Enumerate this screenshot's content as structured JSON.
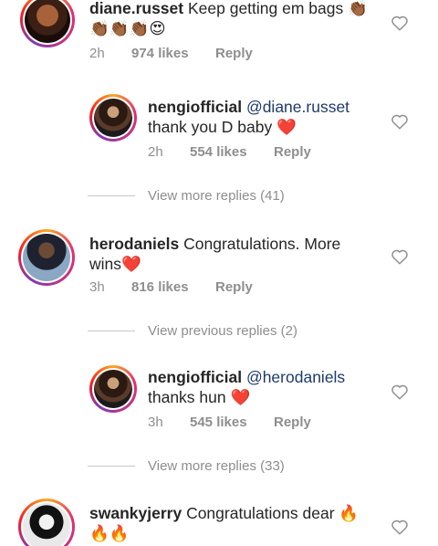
{
  "comments": [
    {
      "username": "diane.russet",
      "text": "Keep getting em bags 👏🏾",
      "text2": "👏🏾👏🏾👏🏾😍",
      "time": "2h",
      "likes": "974 likes",
      "reply": "Reply"
    },
    {
      "username": "nengiofficial",
      "mention": "@diane.russet",
      "text": "thank you D baby",
      "time": "2h",
      "likes": "554 likes",
      "reply": "Reply"
    },
    {
      "more_replies": "View more replies (41)"
    },
    {
      "username": "herodaniels",
      "text": "Congratulations. More",
      "text2": "wins",
      "time": "3h",
      "likes": "816 likes",
      "reply": "Reply"
    },
    {
      "previous_replies": "View previous replies (2)"
    },
    {
      "username": "nengiofficial",
      "mention": "@herodaniels",
      "text": "thanks hun",
      "time": "3h",
      "likes": "545 likes",
      "reply": "Reply"
    },
    {
      "more_replies": "View more replies (33)"
    },
    {
      "username": "swankyjerry",
      "text": "Congratulations dear 🔥",
      "text2": "🔥🔥"
    }
  ],
  "icons": {
    "heart": "heart-outline-icon",
    "red_heart": "❤️"
  },
  "colors": {
    "text": "#262626",
    "meta": "#8e8e8e",
    "mention": "#1e3a6a",
    "heart": "#e0245e"
  }
}
